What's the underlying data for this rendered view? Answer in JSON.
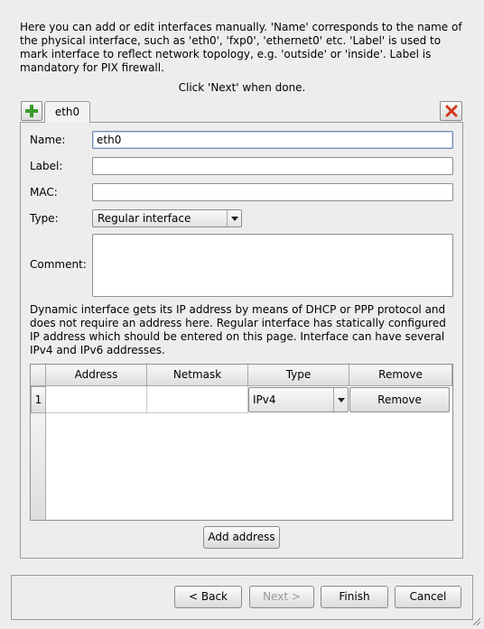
{
  "intro_text": "Here you can add or edit interfaces manually. 'Name' corresponds to the name of the physical interface, such as 'eth0', 'fxp0', 'ethernet0' etc. 'Label' is used to mark interface to reflect network topology, e.g. 'outside' or 'inside'. Label is mandatory for PIX firewall.",
  "click_next_text": "Click 'Next' when done.",
  "tabs": [
    {
      "label": "eth0"
    }
  ],
  "form": {
    "name_label": "Name:",
    "name_value": "eth0",
    "label_label": "Label:",
    "label_value": "",
    "mac_label": "MAC:",
    "mac_value": "",
    "type_label": "Type:",
    "type_value": "Regular interface",
    "comment_label": "Comment:",
    "comment_value": ""
  },
  "dynamic_text": "Dynamic interface gets its IP address by means of DHCP or PPP protocol and does not require an address here. Regular interface has statically configured IP address which should be entered on this page. Interface can have several IPv4 and IPv6 addresses.",
  "address_table": {
    "columns": [
      "Address",
      "Netmask",
      "Type",
      "Remove"
    ],
    "rows": [
      {
        "index": "1",
        "address": "",
        "netmask": "",
        "type": "IPv4",
        "remove": "Remove"
      }
    ]
  },
  "add_address_label": "Add address",
  "buttons": {
    "back": "< Back",
    "next": "Next >",
    "finish": "Finish",
    "cancel": "Cancel"
  },
  "colors": {
    "plus_green": "#3a9a2a",
    "close_red": "#d03a1e"
  }
}
